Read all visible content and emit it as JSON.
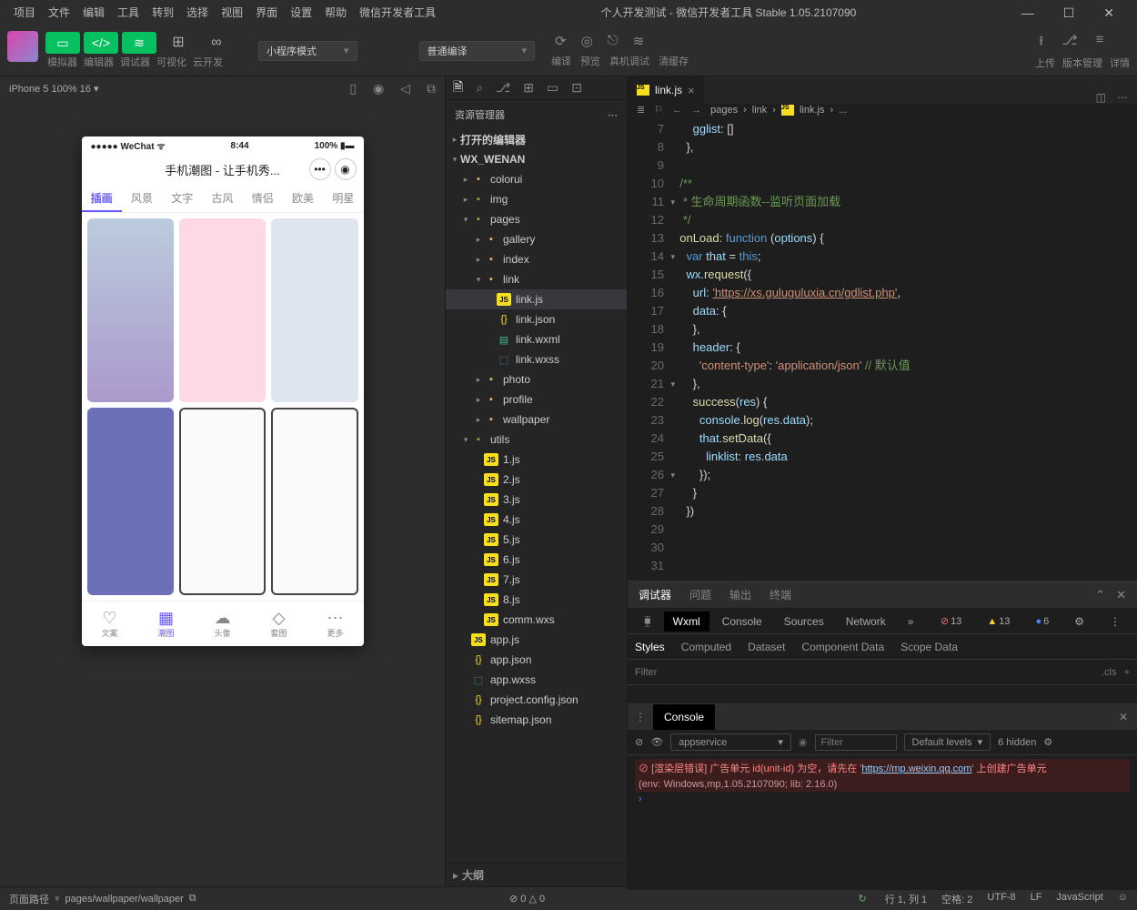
{
  "menu": [
    "项目",
    "文件",
    "编辑",
    "工具",
    "转到",
    "选择",
    "视图",
    "界面",
    "设置",
    "帮助",
    "微信开发者工具"
  ],
  "title": "个人开发测试 - 微信开发者工具 Stable 1.05.2107090",
  "toolbar": {
    "mode_buttons": [
      "模拟器",
      "编辑器",
      "调试器"
    ],
    "viz": "可视化",
    "cloud": "云开发",
    "mode_dd": "小程序模式",
    "compile_dd": "普通编译",
    "actions": [
      "编译",
      "预览",
      "真机调试",
      "清缓存"
    ],
    "right": [
      "上传",
      "版本管理",
      "详情"
    ]
  },
  "sim": {
    "device": "iPhone 5 100% 16",
    "status_l": "●●●●● WeChat",
    "status_c": "8:44",
    "status_r": "100%",
    "app_title": "手机潮图 - 让手机秀...",
    "tabs": [
      "插画",
      "风景",
      "文字",
      "古风",
      "情侣",
      "欧美",
      "明星"
    ],
    "nav": [
      "文案",
      "潮图",
      "头像",
      "套图",
      "更多"
    ]
  },
  "explorer": {
    "title": "资源管理器",
    "sec1": "打开的编辑器",
    "proj": "WX_WENAN",
    "tree": {
      "colorui": "colorui",
      "img": "img",
      "pages": "pages",
      "gallery": "gallery",
      "index": "index",
      "link": "link",
      "linkjs": "link.js",
      "linkjson": "link.json",
      "linkwxml": "link.wxml",
      "linkwxss": "link.wxss",
      "photo": "photo",
      "profile": "profile",
      "wallpaper": "wallpaper",
      "utils": "utils",
      "1js": "1.js",
      "2js": "2.js",
      "3js": "3.js",
      "4js": "4.js",
      "5js": "5.js",
      "6js": "6.js",
      "7js": "7.js",
      "8js": "8.js",
      "commwxs": "comm.wxs",
      "appjs": "app.js",
      "appjson": "app.json",
      "appwxss": "app.wxss",
      "projconf": "project.config.json",
      "sitemap": "sitemap.json"
    },
    "outline": "大纲"
  },
  "editor": {
    "tab": "link.js",
    "crumbs": [
      "pages",
      "link",
      "link.js",
      "..."
    ],
    "code_txt": {
      "l7": "      gglist: []",
      "l8": "    },",
      "l10": "",
      "l11": "  /**",
      "l12": "   * 生命周期函数--监听页面加载",
      "l13": "   */",
      "c_onload": "onLoad",
      "c_function": "function",
      "c_options": "options",
      "c_var": "var",
      "c_that": "that",
      "c_this": "this",
      "c_wx": "wx",
      "c_request": "request",
      "c_url": "url",
      "c_urlval": "'https://xs.guluguluxia.cn/gdlist.php'",
      "c_data": "data",
      "c_header": "header",
      "c_ct": "'content-type'",
      "c_app": "'application/json'",
      "c_def": "// 默认值",
      "c_success": "success",
      "c_res": "res",
      "c_console": "console",
      "c_log": "log",
      "c_setdata": "setData",
      "c_linklist": "linklist"
    }
  },
  "debugger": {
    "tabs": [
      "调试器",
      "问题",
      "输出",
      "终端"
    ],
    "dev": [
      "Wxml",
      "Console",
      "Sources",
      "Network"
    ],
    "badges": {
      "err": "13",
      "warn": "13",
      "info": "6"
    },
    "style_tabs": [
      "Styles",
      "Computed",
      "Dataset",
      "Component Data",
      "Scope Data"
    ],
    "filter_ph": "Filter",
    "cls": ".cls"
  },
  "console": {
    "title": "Console",
    "src": "appservice",
    "filter_ph": "Filter",
    "levels": "Default levels",
    "hidden": "6 hidden",
    "err1": "[渲染层错误] 广告单元 id(unit-id) 为空，请先在 '",
    "err1_link": "https://mp.weixin.qq.com",
    "err1_end": "' 上创建广告单元",
    "env": "(env: Windows,mp,1.05.2107090; lib: 2.16.0)"
  },
  "status": {
    "l1": "页面路径",
    "l2": "pages/wallpaper/wallpaper",
    "mid": "⊘ 0 △ 0",
    "r": [
      "行 1, 列 1",
      "空格: 2",
      "UTF-8",
      "LF",
      "JavaScript"
    ]
  }
}
